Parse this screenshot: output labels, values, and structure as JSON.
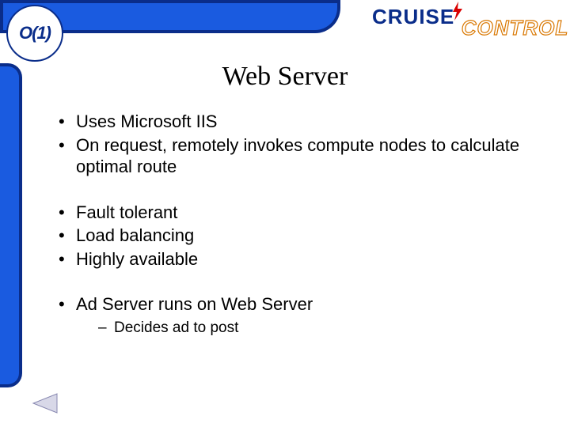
{
  "logo": {
    "text": "O(1)"
  },
  "brand": {
    "cruise": "CRUISE",
    "control": "CONTROL"
  },
  "title": "Web Server",
  "bullets": {
    "b1": "Uses Microsoft IIS",
    "b2": "On request, remotely invokes compute nodes to calculate optimal route",
    "b3": "Fault tolerant",
    "b4": "Load balancing",
    "b5": "Highly available",
    "b6": "Ad Server runs on Web Server",
    "b6s1": "Decides ad to post"
  }
}
